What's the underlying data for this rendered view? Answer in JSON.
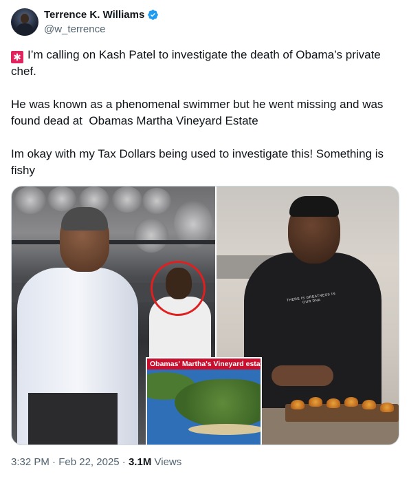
{
  "author": {
    "display_name": "Terrence K. Williams",
    "handle": "@w_terrence",
    "verified": true,
    "verified_color": "#1d9bf0"
  },
  "tweet": {
    "paragraphs": [
      "I’m calling on Kash Patel to investigate the death of Obama’s private chef.",
      "He was known as a phenomenal swimmer but he went missing and was found dead at  Obamas Martha Vineyard Estate",
      "Im okay with my Tax Dollars being used to investigate this! Something is fishy"
    ],
    "leading_emoji": "rotating-light-icon"
  },
  "media": {
    "inset_caption": "Obamas' Martha's Vineyard estate",
    "shirt_text": "THERE IS GREATNESS IN OUR DNA"
  },
  "meta": {
    "time": "3:32 PM",
    "separator": "·",
    "date": "Feb 22, 2025",
    "views_count": "3.1M",
    "views_label": "Views"
  }
}
